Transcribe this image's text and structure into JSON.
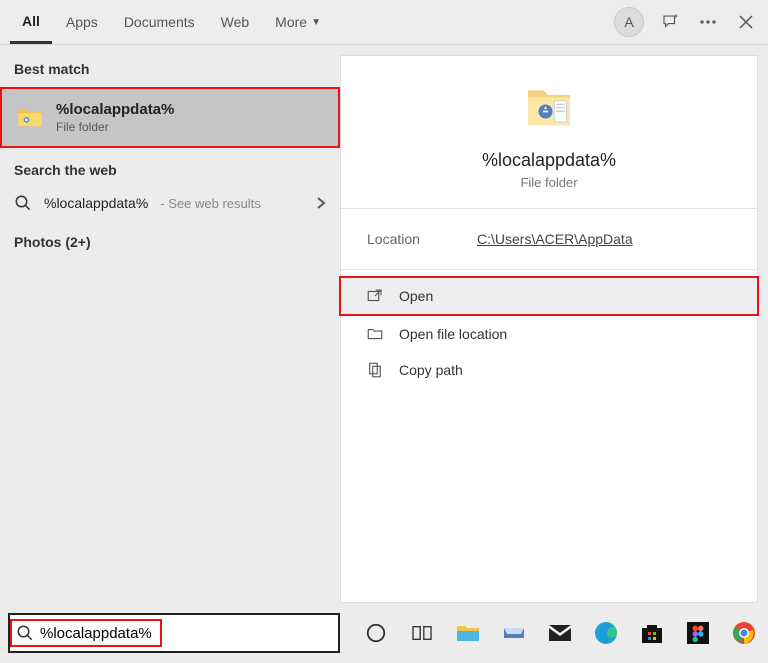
{
  "tabs": {
    "all": "All",
    "apps": "Apps",
    "documents": "Documents",
    "web": "Web",
    "more": "More"
  },
  "avatar_letter": "A",
  "sections": {
    "best_match": "Best match",
    "search_web": "Search the web",
    "photos": "Photos (2+)"
  },
  "best_match": {
    "title": "%localappdata%",
    "subtitle": "File folder"
  },
  "web_search": {
    "term": "%localappdata%",
    "hint": "- See web results"
  },
  "preview": {
    "title": "%localappdata%",
    "subtitle": "File folder",
    "location_label": "Location",
    "location_path": "C:\\Users\\ACER\\AppData"
  },
  "actions": {
    "open": "Open",
    "open_location": "Open file location",
    "copy_path": "Copy path"
  },
  "search_input": {
    "value": "%localappdata%"
  }
}
